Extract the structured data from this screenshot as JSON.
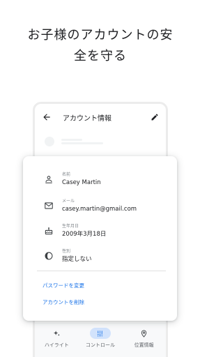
{
  "headline": {
    "line1": "お子様のアカウントの安",
    "line2": "全を守る"
  },
  "phone": {
    "title": "アカウント情報",
    "nav": [
      {
        "label": "ハイライト",
        "icon": "sparkle-icon"
      },
      {
        "label": "コントロール",
        "icon": "tune-icon"
      },
      {
        "label": "位置情報",
        "icon": "location-pin-icon"
      }
    ]
  },
  "card": {
    "fields": [
      {
        "label": "名前",
        "value": "Casey Martin",
        "icon": "person-badge-icon"
      },
      {
        "label": "メール",
        "value": "casey.martin@gmail.com",
        "icon": "mail-icon"
      },
      {
        "label": "生年月日",
        "value": "2009年3月18日",
        "icon": "cake-icon"
      },
      {
        "label": "性別",
        "value": "指定しない",
        "icon": "gender-icon"
      }
    ],
    "links": {
      "change_password": "パスワードを変更",
      "delete_account": "アカウントを削除"
    }
  },
  "colors": {
    "accent": "#1a73e8",
    "nav_active_bg": "#d2e3fc"
  }
}
